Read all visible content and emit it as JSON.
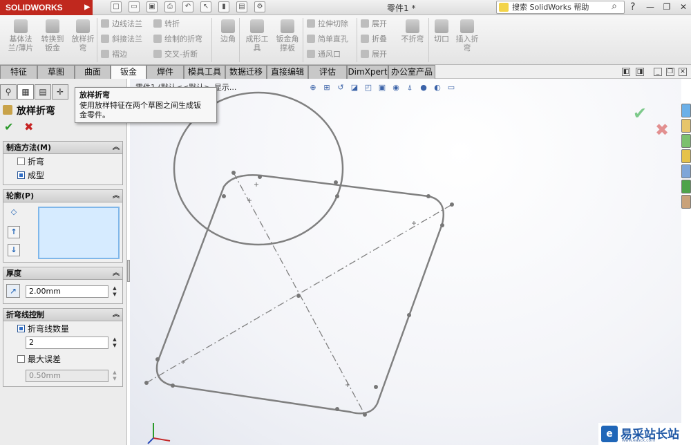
{
  "app": {
    "logo_text": "SOLIDWORKS",
    "doc_title": "零件1 *",
    "search_placeholder": "搜索 SolidWorks 帮助",
    "help_label": "?"
  },
  "ribbon": {
    "big_buttons": [
      {
        "label_1": "基体法",
        "label_2": "兰/薄片"
      },
      {
        "label_1": "转换到",
        "label_2": "钣金"
      },
      {
        "label_1": "放样折",
        "label_2": "弯"
      },
      {
        "label_1": "边角",
        "label_2": ""
      },
      {
        "label_1": "成形工",
        "label_2": "具"
      },
      {
        "label_1": "钣金角",
        "label_2": "撑板"
      },
      {
        "label_1": "不折弯",
        "label_2": ""
      },
      {
        "label_1": "切口",
        "label_2": ""
      },
      {
        "label_1": "插入折",
        "label_2": "弯"
      }
    ],
    "small_buttons": {
      "edge_flange": "边线法兰",
      "miter_flange": "斜接法兰",
      "hem": "褶边",
      "jog": "转折",
      "sketched_bend": "绘制的折弯",
      "cross_break": "交叉-折断",
      "extruded_cut": "拉伸切除",
      "simple_hole": "简单直孔",
      "vent": "通风口",
      "unfold": "展开",
      "fold": "折叠",
      "flatten": "展开"
    }
  },
  "tabs": [
    {
      "label": "特征"
    },
    {
      "label": "草图"
    },
    {
      "label": "曲面"
    },
    {
      "label": "钣金"
    },
    {
      "label": "焊件"
    },
    {
      "label": "模具工具"
    },
    {
      "label": "数据迁移"
    },
    {
      "label": "直接编辑"
    },
    {
      "label": "评估"
    },
    {
      "label": "DimXpert"
    },
    {
      "label": "办公室产品"
    }
  ],
  "tooltip": {
    "title": "放样折弯",
    "line1": "使用放样特征在两个草图之间生成钣",
    "line2": "金零件。"
  },
  "property_manager": {
    "title": "放样折弯",
    "manufacturing": {
      "header": "制造方法(M)",
      "option_bend": "折弯",
      "option_form": "成型",
      "selected": "成型"
    },
    "profile": {
      "header": "轮廓(P)"
    },
    "thickness": {
      "header": "厚度",
      "value": "2.00mm"
    },
    "bend_line": {
      "header": "折弯线控制",
      "count_label": "折弯线数量",
      "count_checked": true,
      "count_value": "2",
      "max_dev_label": "最大误差",
      "max_dev_checked": false,
      "max_dev_value": "0.50mm"
    }
  },
  "viewport": {
    "breadcrumb": "零件1 (默认<<默认>_显示..."
  },
  "watermark": {
    "logo_char": "e",
    "text": "易采站长站",
    "sub": "www.easck.com"
  },
  "colors": {
    "brand_red": "#c0281e",
    "selected_blue": "#2f6ec7",
    "ok_green": "#2d9a2d",
    "cancel_red": "#c62222"
  }
}
